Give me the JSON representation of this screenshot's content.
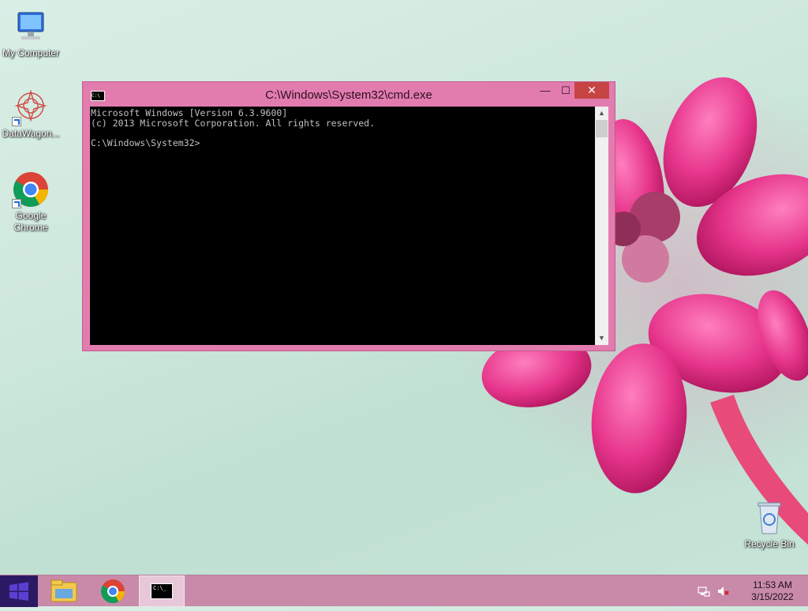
{
  "desktop": {
    "icons": [
      {
        "label": "My Computer"
      },
      {
        "label": "DataWagon..."
      },
      {
        "label": "Google Chrome"
      },
      {
        "label": "Recycle Bin"
      }
    ]
  },
  "window": {
    "title": "C:\\Windows\\System32\\cmd.exe",
    "icon_text": "C:\\",
    "buttons": {
      "minimize": "—",
      "maximize": "☐",
      "close": "✕"
    },
    "console_text": "Microsoft Windows [Version 6.3.9600]\n(c) 2013 Microsoft Corporation. All rights reserved.\n\nC:\\Windows\\System32>"
  },
  "taskbar": {
    "pinned": [
      {
        "name": "file-explorer-icon"
      },
      {
        "name": "chrome-icon"
      },
      {
        "name": "cmd-icon",
        "text": "C:\\_"
      }
    ],
    "clock": {
      "time": "11:53 AM",
      "date": "3/15/2022"
    }
  },
  "colors": {
    "window_frame": "#e37cae",
    "close_button": "#c74444",
    "taskbar": "#c98aa9",
    "start_button": "#2b1a63"
  }
}
